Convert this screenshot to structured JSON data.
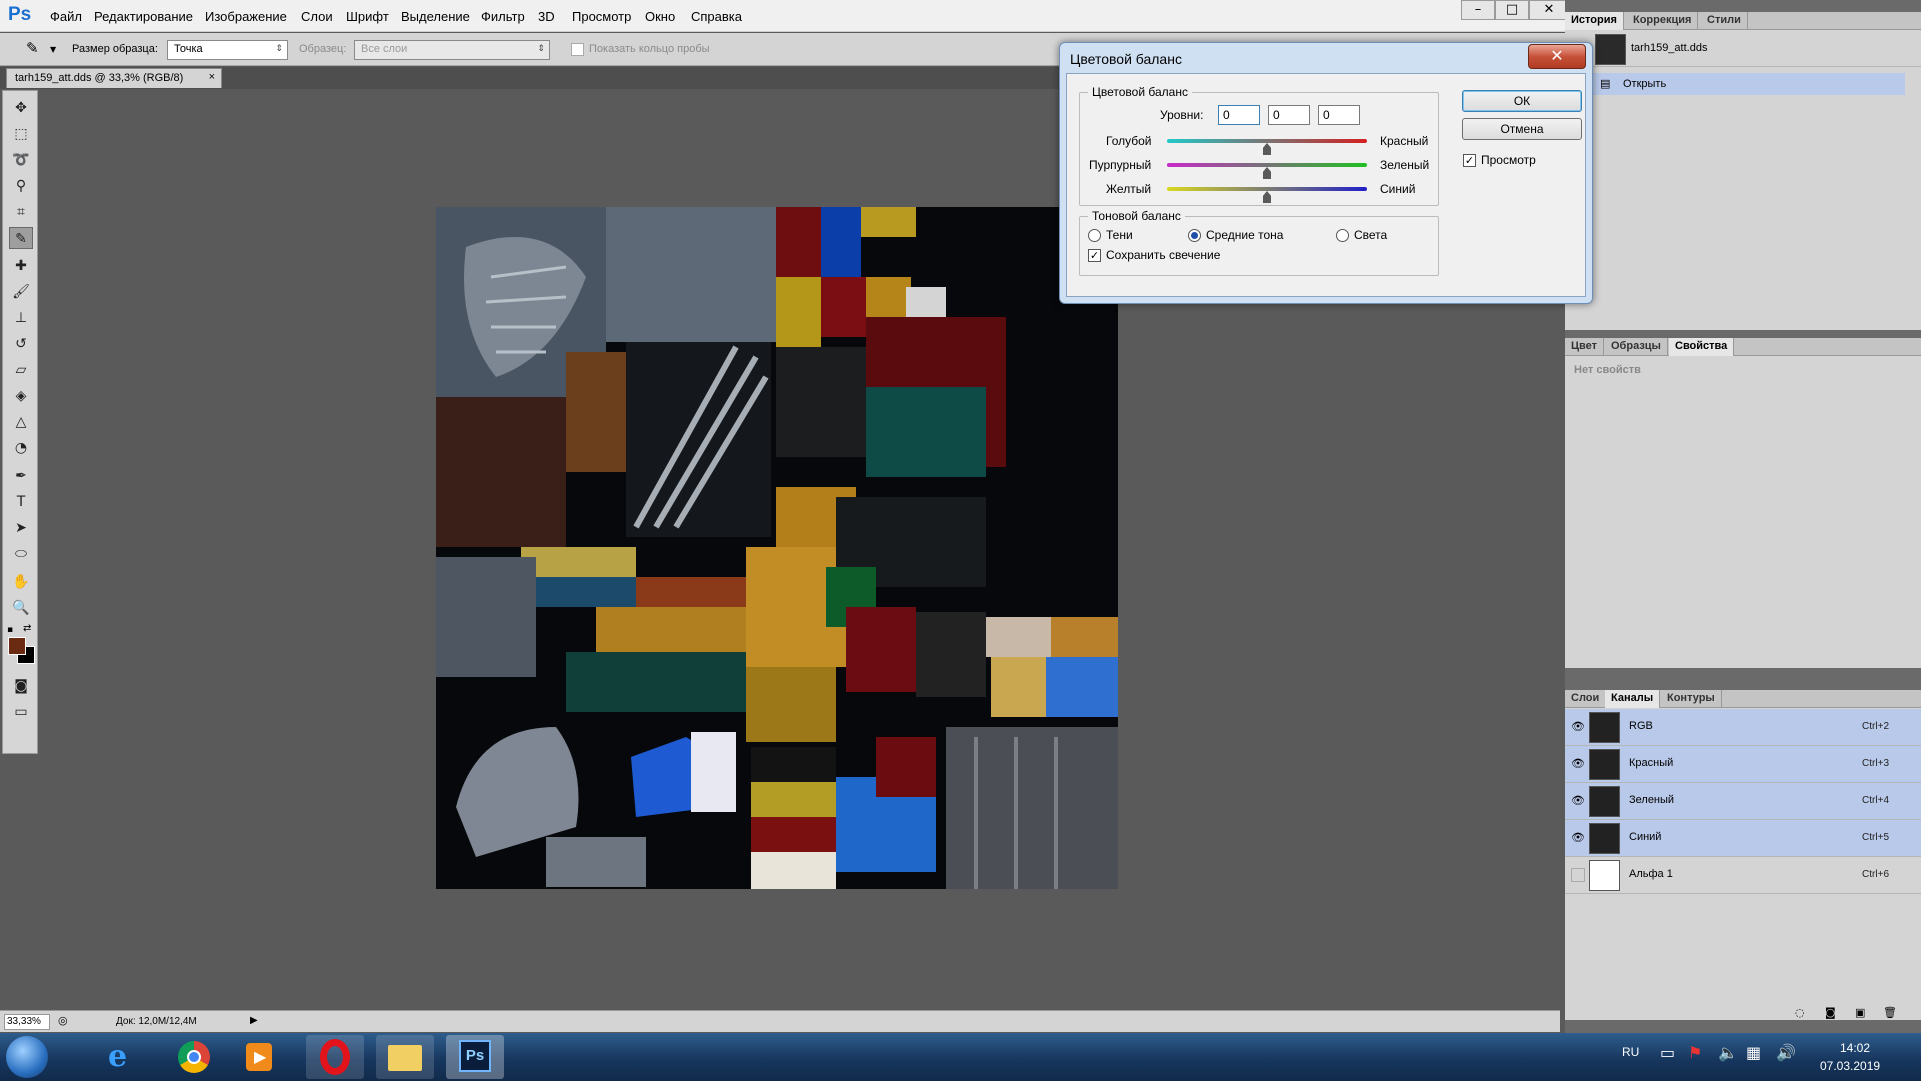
{
  "app": {
    "logo": "Ps"
  },
  "menu": [
    "Файл",
    "Редактирование",
    "Изображение",
    "Слои",
    "Шрифт",
    "Выделение",
    "Фильтр",
    "3D",
    "Просмотр",
    "Окно",
    "Справка"
  ],
  "window_controls": {
    "minimize": "–",
    "maximize": "□",
    "close": "✕"
  },
  "options_bar": {
    "sample_size_label": "Размер образца:",
    "sample_size_value": "Точка",
    "sample_label": "Образец:",
    "sample_value": "Все слои",
    "show_ring_label": "Показать кольцо пробы"
  },
  "document_tab": {
    "title": "tarh159_att.dds @ 33,3% (RGB/8)",
    "close": "×"
  },
  "status_bar": {
    "zoom": "33,33%",
    "doc_info": "Док: 12,0M/12,4M"
  },
  "dialog": {
    "title": "Цветовой баланс",
    "close_glyph": "✕",
    "color_group_label": "Цветовой баланс",
    "levels_label": "Уровни:",
    "levels": [
      "0",
      "0",
      "0"
    ],
    "slider_left": [
      "Голубой",
      "Пурпурный",
      "Желтый"
    ],
    "slider_right": [
      "Красный",
      "Зеленый",
      "Синий"
    ],
    "slider_values": [
      0,
      0,
      0
    ],
    "tone_group_label": "Тоновой баланс",
    "tones": [
      "Тени",
      "Средние тона",
      "Света"
    ],
    "selected_tone": "Средние тона",
    "preserve_luminosity": "Сохранить свечение",
    "ok": "ОК",
    "cancel": "Отмена",
    "preview": "Просмотр"
  },
  "history_panel": {
    "tabs": [
      "История",
      "Коррекция",
      "Стили"
    ],
    "snapshot": "tarh159_att.dds",
    "items": [
      "Открыть"
    ]
  },
  "properties_panel": {
    "tabs": [
      "Цвет",
      "Образцы",
      "Свойства"
    ],
    "empty_text": "Нет свойств"
  },
  "channels_panel": {
    "tabs": [
      "Слои",
      "Каналы",
      "Контуры"
    ],
    "channels": [
      {
        "name": "RGB",
        "shortcut": "Ctrl+2",
        "visible": true
      },
      {
        "name": "Красный",
        "shortcut": "Ctrl+3",
        "visible": true
      },
      {
        "name": "Зеленый",
        "shortcut": "Ctrl+4",
        "visible": true
      },
      {
        "name": "Синий",
        "shortcut": "Ctrl+5",
        "visible": true
      },
      {
        "name": "Альфа 1",
        "shortcut": "Ctrl+6",
        "visible": false
      }
    ]
  },
  "taskbar": {
    "lang": "RU",
    "time": "14:02",
    "date": "07.03.2019",
    "ps_label": "Ps"
  },
  "colors": {
    "foreground": "#6b2a12",
    "background": "#000000",
    "selection": "#b9c9ea"
  }
}
